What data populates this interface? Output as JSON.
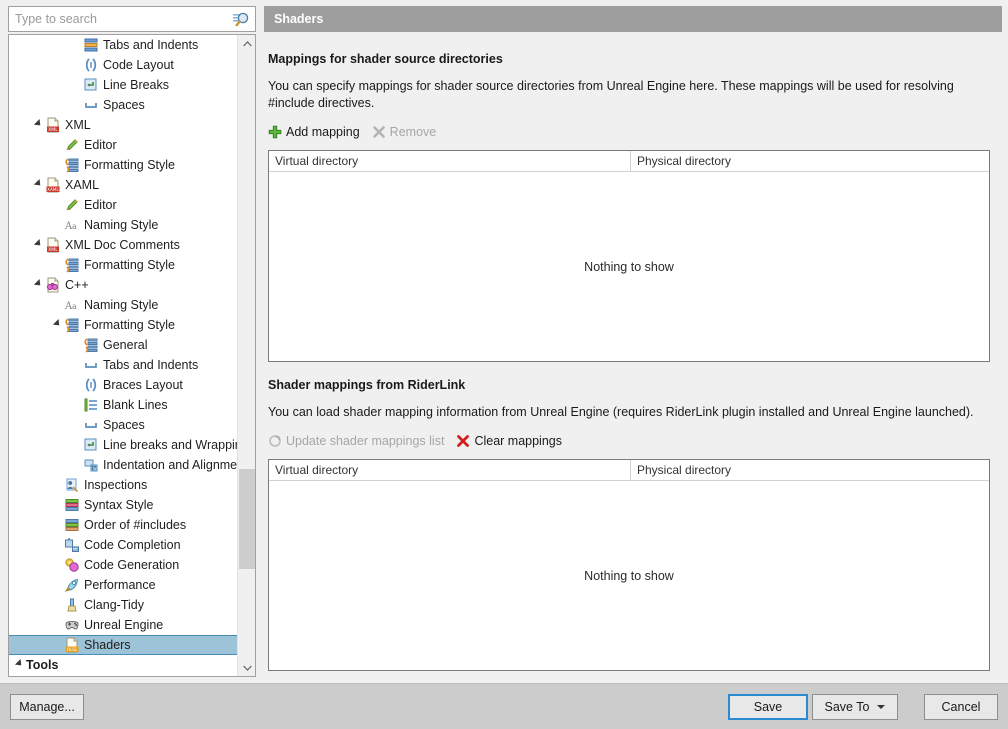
{
  "search": {
    "placeholder": "Type to search",
    "value": "",
    "icon": "search-icon"
  },
  "sidebar": {
    "items": [
      {
        "label": "Tabs and Indents",
        "indent": 3,
        "expander": "none",
        "icon": "tabs-indents-icon",
        "selected": false,
        "bold": false
      },
      {
        "label": "Code Layout",
        "indent": 3,
        "expander": "none",
        "icon": "code-layout-icon",
        "selected": false,
        "bold": false
      },
      {
        "label": "Line Breaks",
        "indent": 3,
        "expander": "none",
        "icon": "line-breaks-icon",
        "selected": false,
        "bold": false
      },
      {
        "label": "Spaces",
        "indent": 3,
        "expander": "none",
        "icon": "spaces-icon",
        "selected": false,
        "bold": false
      },
      {
        "label": "XML",
        "indent": 1,
        "expander": "expanded",
        "icon": "xml-file-icon",
        "selected": false,
        "bold": false
      },
      {
        "label": "Editor",
        "indent": 2,
        "expander": "none",
        "icon": "pencil-icon",
        "selected": false,
        "bold": false
      },
      {
        "label": "Formatting Style",
        "indent": 2,
        "expander": "none",
        "icon": "formatting-icon",
        "selected": false,
        "bold": false
      },
      {
        "label": "XAML",
        "indent": 1,
        "expander": "expanded",
        "icon": "xaml-file-icon",
        "selected": false,
        "bold": false
      },
      {
        "label": "Editor",
        "indent": 2,
        "expander": "none",
        "icon": "pencil-icon",
        "selected": false,
        "bold": false
      },
      {
        "label": "Naming Style",
        "indent": 2,
        "expander": "none",
        "icon": "naming-style-icon",
        "selected": false,
        "bold": false
      },
      {
        "label": "XML Doc Comments",
        "indent": 1,
        "expander": "expanded",
        "icon": "xml-file-icon",
        "selected": false,
        "bold": false
      },
      {
        "label": "Formatting Style",
        "indent": 2,
        "expander": "none",
        "icon": "formatting-icon",
        "selected": false,
        "bold": false
      },
      {
        "label": "C++",
        "indent": 1,
        "expander": "expanded",
        "icon": "cpp-icon",
        "selected": false,
        "bold": false
      },
      {
        "label": "Naming Style",
        "indent": 2,
        "expander": "none",
        "icon": "naming-style-icon",
        "selected": false,
        "bold": false
      },
      {
        "label": "Formatting Style",
        "indent": 2,
        "expander": "expanded",
        "icon": "formatting-icon",
        "selected": false,
        "bold": false
      },
      {
        "label": "General",
        "indent": 3,
        "expander": "none",
        "icon": "formatting-icon",
        "selected": false,
        "bold": false
      },
      {
        "label": "Tabs and Indents",
        "indent": 3,
        "expander": "none",
        "icon": "spaces-icon",
        "selected": false,
        "bold": false
      },
      {
        "label": "Braces Layout",
        "indent": 3,
        "expander": "none",
        "icon": "code-layout-icon",
        "selected": false,
        "bold": false
      },
      {
        "label": "Blank Lines",
        "indent": 3,
        "expander": "none",
        "icon": "blank-lines-icon",
        "selected": false,
        "bold": false
      },
      {
        "label": "Spaces",
        "indent": 3,
        "expander": "none",
        "icon": "spaces-icon",
        "selected": false,
        "bold": false
      },
      {
        "label": "Line breaks and Wrapping",
        "indent": 3,
        "expander": "none",
        "icon": "line-breaks-icon",
        "selected": false,
        "bold": false
      },
      {
        "label": "Indentation and Alignment",
        "indent": 3,
        "expander": "none",
        "icon": "indentation-icon",
        "selected": false,
        "bold": false
      },
      {
        "label": "Inspections",
        "indent": 2,
        "expander": "none",
        "icon": "inspections-icon",
        "selected": false,
        "bold": false
      },
      {
        "label": "Syntax Style",
        "indent": 2,
        "expander": "none",
        "icon": "syntax-style-icon",
        "selected": false,
        "bold": false
      },
      {
        "label": "Order of #includes",
        "indent": 2,
        "expander": "none",
        "icon": "includes-icon",
        "selected": false,
        "bold": false
      },
      {
        "label": "Code Completion",
        "indent": 2,
        "expander": "none",
        "icon": "completion-icon",
        "selected": false,
        "bold": false
      },
      {
        "label": "Code Generation",
        "indent": 2,
        "expander": "none",
        "icon": "generation-icon",
        "selected": false,
        "bold": false
      },
      {
        "label": "Performance",
        "indent": 2,
        "expander": "none",
        "icon": "rocket-icon",
        "selected": false,
        "bold": false
      },
      {
        "label": "Clang-Tidy",
        "indent": 2,
        "expander": "none",
        "icon": "clang-tidy-icon",
        "selected": false,
        "bold": false
      },
      {
        "label": "Unreal Engine",
        "indent": 2,
        "expander": "none",
        "icon": "gamepad-icon",
        "selected": false,
        "bold": false
      },
      {
        "label": "Shaders",
        "indent": 2,
        "expander": "none",
        "icon": "hlsl-file-icon",
        "selected": true,
        "bold": false
      },
      {
        "label": "Tools",
        "indent": 0,
        "expander": "expanded",
        "icon": "none",
        "selected": false,
        "bold": true
      }
    ]
  },
  "page": {
    "header_title": "Shaders",
    "sections": [
      {
        "title": "Mappings for shader source directories",
        "description": "You can specify mappings for shader source directories from Unreal Engine here. These mappings will be used for resolving #include directives.",
        "toolbar": [
          {
            "label": "Add mapping",
            "icon": "plus-green-icon",
            "disabled": false
          },
          {
            "label": "Remove",
            "icon": "x-gray-icon",
            "disabled": true
          }
        ],
        "columns": [
          "Virtual directory",
          "Physical directory"
        ],
        "empty_text": "Nothing to show",
        "rows": []
      },
      {
        "title": "Shader mappings from RiderLink",
        "description": "You can load shader mapping information from Unreal Engine (requires RiderLink plugin installed and Unreal Engine launched).",
        "toolbar": [
          {
            "label": "Update shader mappings list",
            "icon": "refresh-gray-icon",
            "disabled": true
          },
          {
            "label": "Clear mappings",
            "icon": "x-red-icon",
            "disabled": false
          }
        ],
        "columns": [
          "Virtual directory",
          "Physical directory"
        ],
        "empty_text": "Nothing to show",
        "rows": []
      }
    ]
  },
  "footer": {
    "manage_label": "Manage...",
    "save_label": "Save",
    "save_to_label": "Save To",
    "cancel_label": "Cancel"
  },
  "colors": {
    "header_bar": "#9e9e9e",
    "selection": "#9dc3d8",
    "selection_border": "#4a8cb5",
    "focus_border": "#2a8ad4",
    "footer_bg": "#cccccc",
    "accent_green": "#4caf3c",
    "accent_red": "#d02020"
  }
}
